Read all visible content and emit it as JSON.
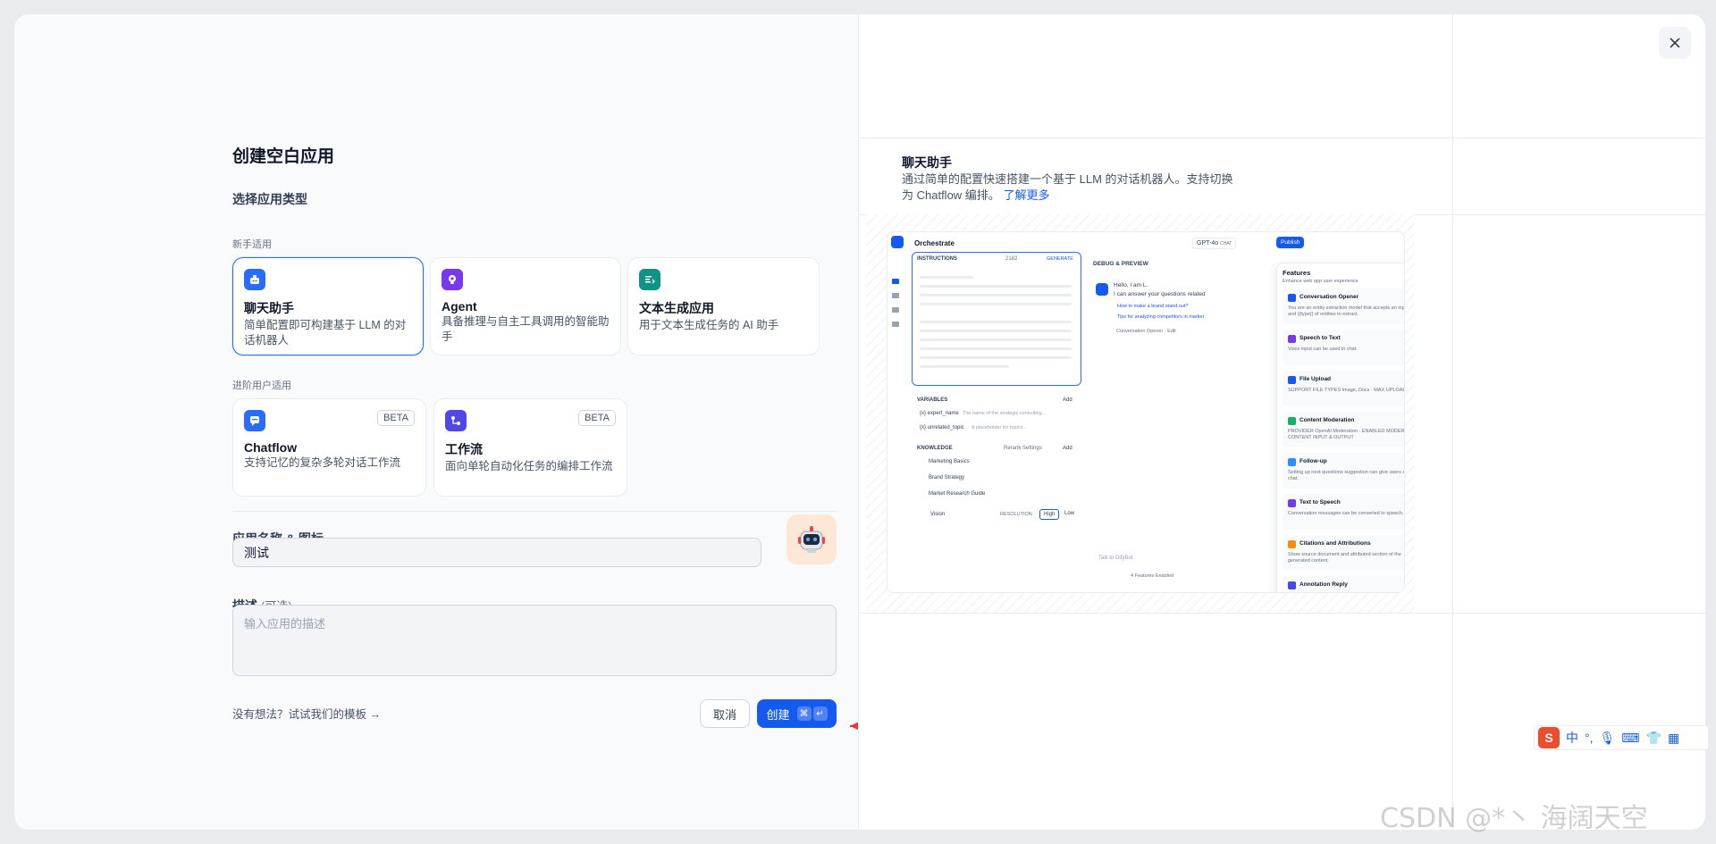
{
  "dialog": {
    "title": "创建空白应用",
    "choose_type": "选择应用类型",
    "section_beginner": "新手适用",
    "section_advanced": "进阶用户适用",
    "close_icon": "close-icon"
  },
  "app_types": [
    {
      "title": "聊天助手",
      "desc": "简单配置即可构建基于 LLM 的对话机器人",
      "color": "#296dff",
      "selected": true
    },
    {
      "title": "Agent",
      "desc": "具备推理与自主工具调用的智能助手",
      "color": "#7839ee",
      "selected": false
    },
    {
      "title": "文本生成应用",
      "desc": "用于文本生成任务的 AI 助手",
      "color": "#0e9384",
      "selected": false
    }
  ],
  "advanced_types": [
    {
      "title": "Chatflow",
      "desc": "支持记忆的复杂多轮对话工作流",
      "badge": "BETA",
      "color": "#296dff"
    },
    {
      "title": "工作流",
      "desc": "面向单轮自动化任务的编排工作流",
      "badge": "BETA",
      "color": "#4f46e5"
    }
  ],
  "form": {
    "name_label": "应用名称 & 图标",
    "name_value": "测试",
    "desc_label": "描述",
    "desc_optional": "(可选)",
    "desc_placeholder": "输入应用的描述"
  },
  "footer": {
    "template_link": "没有想法？试试我们的模板 →",
    "cancel": "取消",
    "create": "创建",
    "shortcut_cmd": "⌘",
    "shortcut_enter": "↵"
  },
  "info": {
    "title": "聊天助手",
    "desc": "通过简单的配置快速搭建一个基于 LLM 的对话机器人。支持切换为 Chatflow 编排。",
    "learn_more": "了解更多"
  },
  "preview": {
    "orchestrate": "Orchestrate",
    "model": "GPT-4o",
    "model_tag": "CHAT",
    "publish": "Publish",
    "instructions": "INSTRUCTIONS",
    "token_count": "2182",
    "generate": "GENERATE",
    "debug": "DEBUG & PREVIEW",
    "hello": "Hello, I am L.",
    "can_answer": "I can answer your questions related",
    "suggest_1": "How to make a brand stand out?",
    "suggest_2": "Tips for analyzing competitors in market",
    "opener": "Conversation Opener · Edit",
    "variables": "VARIABLES",
    "add": "Add",
    "var_1": "{x} expert_name",
    "var_1_desc": "The name of the strategic consulting...",
    "var_1_type": "String",
    "var_2": "{x} unrelated_topic",
    "var_2_desc": "A placeholder for topics...",
    "var_2_req": "REQUIRED",
    "var_2_type": "String",
    "knowledge": "KNOWLEDGE",
    "rerank": "Rerank Settings",
    "kb_1": "Marketing Basics",
    "kb_2": "Brand Strategy",
    "kb_3": "Market Research Guide",
    "kb_tag_1": "HQ · HYBRID",
    "kb_tag_2": "HQ · INVERTED",
    "kb_tag_3": "HQ · HYBRID",
    "vision": "Vision",
    "resolution": "RESOLUTION",
    "high": "High",
    "low": "Low",
    "talk_placeholder": "Talk to DifyBot",
    "features_enabled": "4 Features Enabled",
    "features_title": "Features",
    "features_sub": "Enhance web app user experience",
    "features": [
      {
        "title": "Conversation Opener",
        "desc": "You are an entity extraction model that accepts an input text and {{type}} of entities to extract.",
        "on": true,
        "color": "#155aef"
      },
      {
        "title": "Speech to Text",
        "desc": "Voice input can be used in chat.",
        "on": true,
        "color": "#7839ee"
      },
      {
        "title": "File Upload",
        "desc": "SUPPORT FILE TYPES Image, Docs · MAX UPLOADS 3",
        "on": true,
        "color": "#155aef"
      },
      {
        "title": "Content Moderation",
        "desc": "PROVIDER OpenAI Moderation · ENABLED MODERATE CONTENT INPUT & OUTPUT",
        "on": true,
        "color": "#16b364"
      },
      {
        "title": "Follow-up",
        "desc": "Setting up next questions suggestion can give users a better chat.",
        "on": false,
        "color": "#2e90fa"
      },
      {
        "title": "Text to Speech",
        "desc": "Conversation messages can be converted to speech.",
        "on": false,
        "color": "#7839ee"
      },
      {
        "title": "Citations and Attributions",
        "desc": "Show source document and attributed section of the generated content.",
        "on": false,
        "color": "#f79009"
      },
      {
        "title": "Annotation Reply",
        "desc": "",
        "on": false,
        "color": "#444ce7"
      }
    ]
  },
  "ime": {
    "logo": "S",
    "lang": "中",
    "punct": "°,"
  },
  "watermark": "CSDN @*丶 海阔天空"
}
